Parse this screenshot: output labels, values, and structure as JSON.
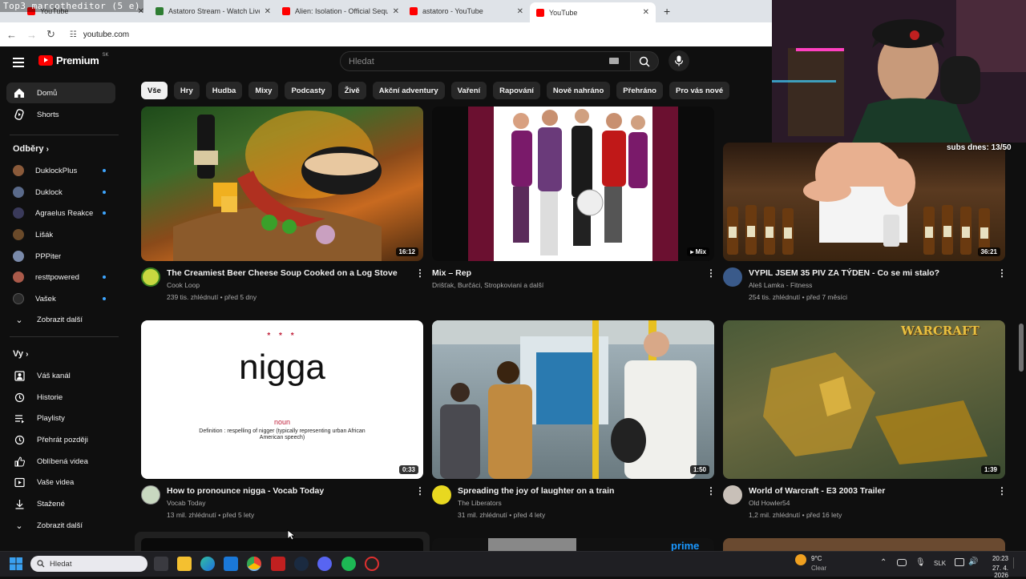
{
  "overlay_title": "Top3 marcotheditor (5 e)",
  "browser": {
    "tabs": [
      {
        "title": "YouTube",
        "color": "#ff0000"
      },
      {
        "title": "Astatoro Stream - Watch Live o",
        "color": "#2e7d32"
      },
      {
        "title": "Alien: Isolation - Official Seque",
        "color": "#ff0000"
      },
      {
        "title": "astatoro - YouTube",
        "color": "#ff0000"
      },
      {
        "title": "YouTube",
        "color": "#ff0000"
      }
    ],
    "new_tab": "+",
    "url": "youtube.com"
  },
  "header": {
    "logo_text": "Premium",
    "region": "SK",
    "search_placeholder": "Hledat"
  },
  "chips": [
    "Vše",
    "Hry",
    "Hudba",
    "Mixy",
    "Podcasty",
    "Živě",
    "Akční adventury",
    "Vaření",
    "Rapování",
    "Nově nahráno",
    "Přehráno",
    "Pro vás nové"
  ],
  "sidebar": {
    "home": "Domů",
    "shorts": "Shorts",
    "subs_heading": "Odběry",
    "subs": [
      {
        "name": "DuklockPlus",
        "color": "#8a5a3a"
      },
      {
        "name": "Duklock",
        "color": "#5a6a8a"
      },
      {
        "name": "Agraelus Reakce",
        "color": "#3a3a5a"
      },
      {
        "name": "Lišák",
        "color": "#6a4a2a"
      },
      {
        "name": "PPPiter",
        "color": "#7a8aaa"
      },
      {
        "name": "resttpowered",
        "color": "#aa5a4a"
      },
      {
        "name": "Vašek",
        "color": "#2a2a2a"
      }
    ],
    "show_more_subs": "Zobrazit další",
    "you_heading": "Vy",
    "you_items": [
      {
        "label": "Váš kanál",
        "icon": "channel-icon"
      },
      {
        "label": "Historie",
        "icon": "history-icon"
      },
      {
        "label": "Playlisty",
        "icon": "playlist-icon"
      },
      {
        "label": "Přehrát později",
        "icon": "watch-later-icon"
      },
      {
        "label": "Oblíbená videa",
        "icon": "like-icon"
      },
      {
        "label": "Vaše videa",
        "icon": "your-videos-icon"
      },
      {
        "label": "Stažené",
        "icon": "download-icon"
      },
      {
        "label": "Zobrazit další",
        "icon": "chevron-down-icon"
      }
    ]
  },
  "videos": [
    {
      "title": "The Creamiest Beer Cheese Soup Cooked on a Log Stove",
      "channel": "Cook Loop",
      "meta": "239 tis. zhlédnutí • před 5 dny",
      "duration": "16:12"
    },
    {
      "title": "Mix – Rep",
      "channel": "Drišťak, Burčáci, Stropkoviani a další",
      "meta": "",
      "duration": "Mix"
    },
    {
      "title": "VYPIL JSEM 35 PIV ZA TÝDEN - Co se mi stalo?",
      "channel": "Aleš Lamka - Fitness",
      "meta": "254 tis. zhlédnutí • před 7 měsíci",
      "duration": "36:21"
    },
    {
      "title": "How to pronounce nigga - Vocab Today",
      "channel": "Vocab Today",
      "meta": "13 mil. zhlédnutí • před 5 lety",
      "duration": "0:33"
    },
    {
      "title": "Spreading the joy of laughter on a train",
      "channel": "The Liberators",
      "meta": "31 mil. zhlédnutí • před 4 lety",
      "duration": "1:50"
    },
    {
      "title": "World of Warcraft - E3 2003 Trailer",
      "channel": "Old Howler54",
      "meta": "1,2 mil. zhlédnutí • před 16 lety",
      "duration": "1:39"
    }
  ],
  "vocab_thumb": {
    "stars": "* * *",
    "word": "nigga",
    "pos": "noun",
    "definition": "Definition : respelling of nigger (typically representing urban African American speech)"
  },
  "wow_logo": "WARCRAFT",
  "prime_text": "prime",
  "webcam_subs": "subs dnes: 13/50",
  "taskbar": {
    "search": "Hledat",
    "weather_temp": "9°C",
    "weather_text": "Clear",
    "lang": "SLK",
    "time": "20:23",
    "date": "27. 4. 2026"
  }
}
